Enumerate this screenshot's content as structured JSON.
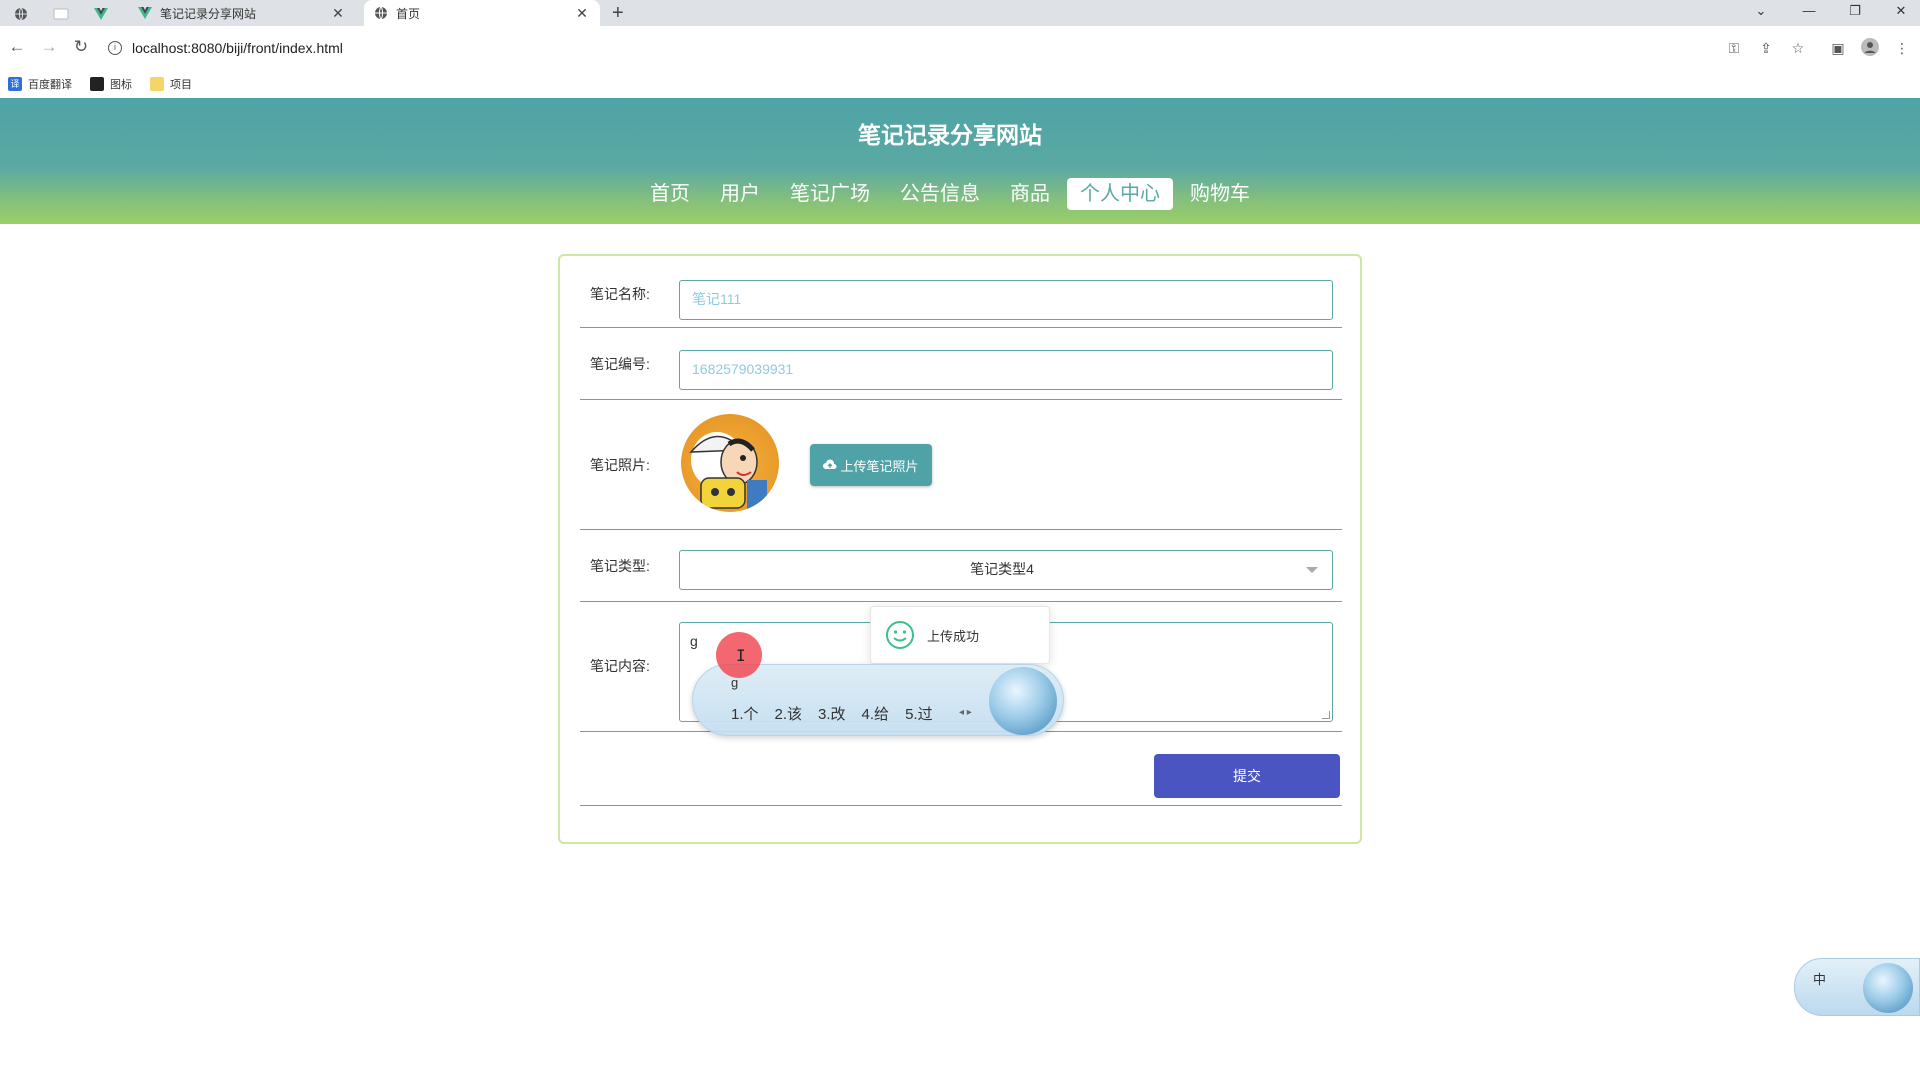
{
  "browser": {
    "tabs": [
      {
        "title": "笔记记录分享网站",
        "active": false
      },
      {
        "title": "首页",
        "active": true
      }
    ],
    "new_tab": "+",
    "url": "localhost:8080/biji/front/index.html",
    "bookmarks": [
      {
        "label": "百度翻译",
        "icon": "translate-icon"
      },
      {
        "label": "图标",
        "icon": "image-icon"
      },
      {
        "label": "项目",
        "icon": "folder-icon"
      }
    ]
  },
  "site": {
    "title": "笔记记录分享网站",
    "nav": [
      "首页",
      "用户",
      "笔记广场",
      "公告信息",
      "商品",
      "个人中心",
      "购物车"
    ],
    "active_nav": "个人中心"
  },
  "form": {
    "name_label": "笔记名称:",
    "name_value": "笔记111",
    "number_label": "笔记编号:",
    "number_value": "1682579039931",
    "photo_label": "笔记照片:",
    "upload_button": "上传笔记照片",
    "type_label": "笔记类型:",
    "type_value": "笔记类型4",
    "content_label": "笔记内容:",
    "content_value": "g",
    "submit_button": "提交"
  },
  "toast": {
    "message": "上传成功"
  },
  "ime": {
    "pinyin": "g",
    "candidates": [
      "1.个",
      "2.该",
      "3.改",
      "4.给",
      "5.过"
    ],
    "mode": "中"
  }
}
